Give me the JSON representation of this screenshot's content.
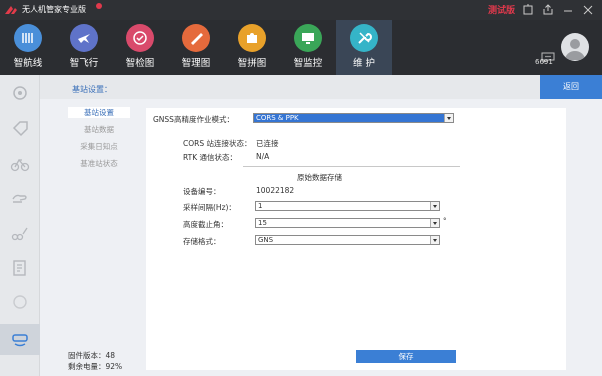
{
  "window": {
    "title": "无人机管家专业版",
    "test_label": "测试版"
  },
  "nav": {
    "items": [
      {
        "label": "智航线",
        "color": "#4a8fd9"
      },
      {
        "label": "智飞行",
        "color": "#5f73c9"
      },
      {
        "label": "智检图",
        "color": "#d94a6b"
      },
      {
        "label": "智理图",
        "color": "#e56a3c"
      },
      {
        "label": "智拼图",
        "color": "#e8a12a"
      },
      {
        "label": "智监控",
        "color": "#3aa658"
      },
      {
        "label": "维 护",
        "color": "#35b4c8"
      }
    ],
    "user_id": "6691"
  },
  "breadcrumb": "基站设置：",
  "back_label": "返回",
  "submenu": [
    "基站设置",
    "基站数据",
    "采集日知点",
    "基准站状态"
  ],
  "form": {
    "mode_label": "GNSS高精度作业模式：",
    "mode_value": "CORS & PPK",
    "cors_label": "CORS 站连接状态：",
    "cors_value": "已连接",
    "rtk_label": "RTK 通信状态：",
    "rtk_value": "N/A",
    "section_title": "原始数据存储",
    "device_label": "设备编号：",
    "device_value": "10022182",
    "interval_label": "采样间隔(Hz)：",
    "interval_value": "1",
    "elev_label": "高度截止角：",
    "elev_value": "15",
    "elev_unit": "°",
    "format_label": "存储格式：",
    "format_value": "GNS",
    "save_label": "保存"
  },
  "footer": {
    "firmware": "固件版本：48",
    "battery": "剩余电量：92%"
  }
}
